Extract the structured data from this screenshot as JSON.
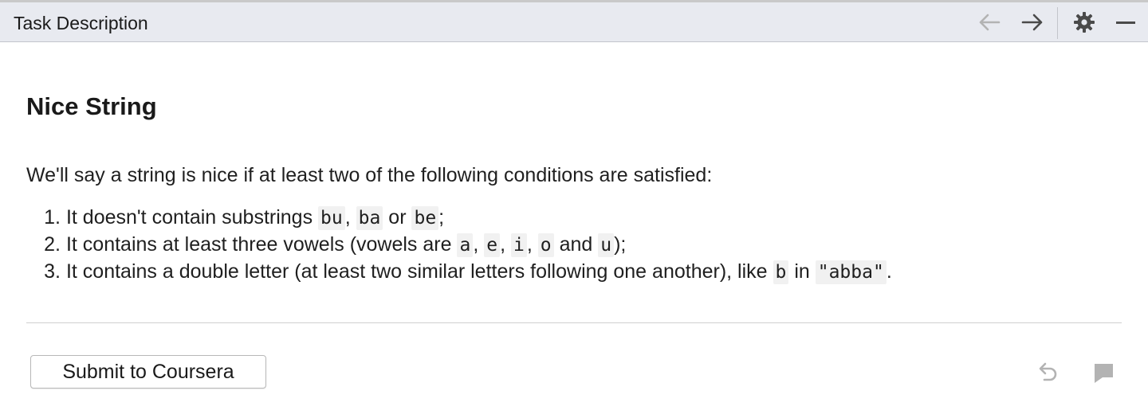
{
  "window": {
    "title": "Task Description",
    "toolbar_icons": [
      "arrow-left-icon",
      "arrow-right-icon",
      "gear-icon",
      "minimize-icon"
    ]
  },
  "task": {
    "heading": "Nice String",
    "intro": "We'll say a string is nice if at least two of the following conditions are satisfied:",
    "conditions": [
      {
        "number": "1.",
        "parts": [
          {
            "t": "It doesn't contain substrings "
          },
          {
            "c": "bu"
          },
          {
            "t": ", "
          },
          {
            "c": "ba"
          },
          {
            "t": " or "
          },
          {
            "c": "be"
          },
          {
            "t": ";"
          }
        ]
      },
      {
        "number": "2.",
        "parts": [
          {
            "t": "It contains at least three vowels (vowels are "
          },
          {
            "c": "a"
          },
          {
            "t": ", "
          },
          {
            "c": "e"
          },
          {
            "t": ", "
          },
          {
            "c": "i"
          },
          {
            "t": ", "
          },
          {
            "c": "o"
          },
          {
            "t": " and "
          },
          {
            "c": "u"
          },
          {
            "t": ");"
          }
        ]
      },
      {
        "number": "3.",
        "parts": [
          {
            "t": "It contains a double letter (at least two similar letters following one another), like "
          },
          {
            "c": "b"
          },
          {
            "t": " in "
          },
          {
            "c": "\"abba\""
          },
          {
            "t": "."
          }
        ]
      }
    ]
  },
  "footer": {
    "submit_label": "Submit to Coursera",
    "icons": [
      "undo-icon",
      "comment-icon"
    ]
  },
  "colors": {
    "titlebar_bg": "#e8eaf0",
    "code_bg": "#f1f1f1",
    "icon_active": "#4a4a4a",
    "icon_disabled": "#b3b3b3"
  }
}
